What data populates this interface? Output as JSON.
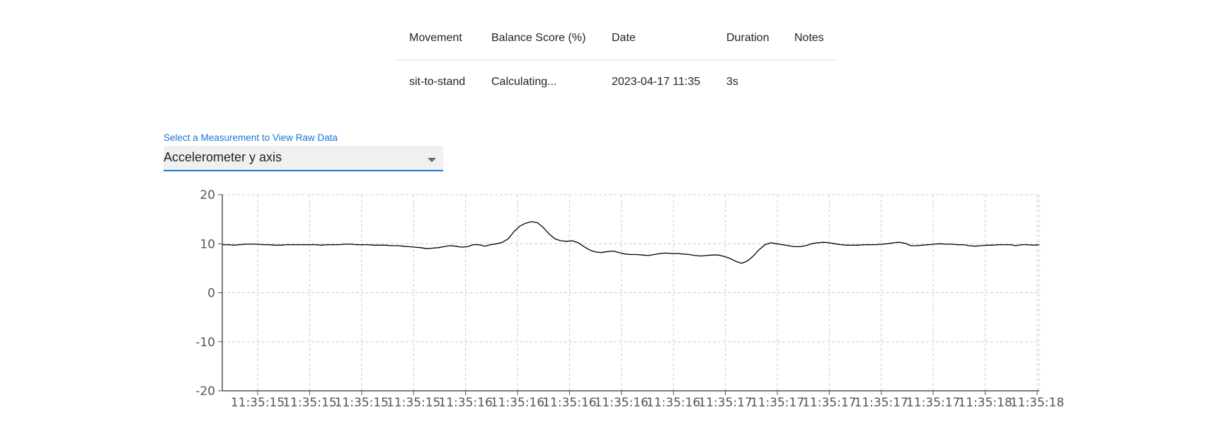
{
  "table": {
    "headers": [
      "Movement",
      "Balance Score (%)",
      "Date",
      "Duration",
      "Notes"
    ],
    "rows": [
      [
        "sit-to-stand",
        "Calculating...",
        "2023-04-17 11:35",
        "3s",
        ""
      ]
    ]
  },
  "measurement_select": {
    "label": "Select a Measurement to View Raw Data",
    "value": "Accelerometer y axis"
  },
  "colors": {
    "accent": "#1976d2",
    "line": "#000000",
    "grid": "#cccccc"
  },
  "chart_data": {
    "type": "line",
    "title": "",
    "xlabel": "",
    "ylabel": "",
    "ylim": [
      -20,
      20
    ],
    "y_ticks": [
      "20",
      "10",
      "0",
      "-10",
      "-20"
    ],
    "x_ticks": [
      "11:35:15",
      "11:35:15",
      "11:35:15",
      "11:35:15",
      "11:35:16",
      "11:35:16",
      "11:35:16",
      "11:35:16",
      "11:35:16",
      "11:35:17",
      "11:35:17",
      "11:35:17",
      "11:35:17",
      "11:35:17",
      "11:35:18",
      "11:35:18"
    ],
    "grid": true,
    "series": [
      {
        "name": "",
        "values": [
          9.8,
          9.8,
          9.7,
          9.8,
          9.9,
          9.9,
          9.9,
          9.8,
          9.8,
          9.7,
          9.7,
          9.8,
          9.8,
          9.8,
          9.8,
          9.8,
          9.8,
          9.7,
          9.8,
          9.8,
          9.8,
          9.9,
          9.9,
          9.8,
          9.8,
          9.8,
          9.7,
          9.7,
          9.7,
          9.6,
          9.6,
          9.5,
          9.4,
          9.3,
          9.2,
          9.0,
          9.1,
          9.2,
          9.4,
          9.6,
          9.5,
          9.3,
          9.4,
          9.8,
          9.8,
          9.5,
          9.8,
          10.0,
          10.3,
          11.0,
          12.5,
          13.6,
          14.2,
          14.5,
          14.3,
          13.3,
          12.0,
          11.0,
          10.6,
          10.5,
          10.6,
          10.2,
          9.4,
          8.7,
          8.3,
          8.2,
          8.4,
          8.5,
          8.2,
          7.9,
          7.8,
          7.8,
          7.7,
          7.6,
          7.8,
          8.0,
          8.1,
          8.0,
          8.0,
          7.9,
          7.8,
          7.6,
          7.5,
          7.6,
          7.7,
          7.7,
          7.4,
          7.0,
          6.4,
          6.0,
          6.5,
          7.5,
          8.8,
          9.8,
          10.2,
          10.0,
          9.8,
          9.6,
          9.4,
          9.4,
          9.6,
          10.0,
          10.2,
          10.3,
          10.2,
          10.0,
          9.8,
          9.7,
          9.7,
          9.7,
          9.8,
          9.8,
          9.8,
          9.9,
          10.0,
          10.2,
          10.3,
          10.1,
          9.6,
          9.6,
          9.7,
          9.8,
          9.9,
          10.0,
          9.9,
          9.9,
          9.8,
          9.8,
          9.6,
          9.5,
          9.6,
          9.7,
          9.7,
          9.8,
          9.8,
          9.8,
          9.6,
          9.8,
          9.8,
          9.7,
          9.8
        ]
      }
    ]
  }
}
